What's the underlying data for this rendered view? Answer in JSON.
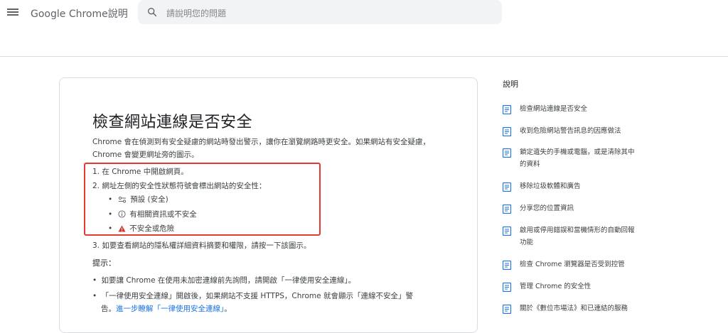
{
  "header": {
    "app_title": "Google Chrome說明",
    "search_placeholder": "請說明您的問題"
  },
  "article": {
    "title": "檢查網站連線是否安全",
    "intro": "Chrome 會在偵測到有安全疑慮的網站時發出警示，讓你在瀏覽網路時更安全。如果網站有安全疑慮，Chrome 會變更網址旁的圖示。",
    "steps": [
      "1. 在 Chrome 中開啟網頁。",
      "2. 網址左側的安全性狀態符號會標出網站的安全性：",
      "3. 如要查看網站的隱私權詳細資料摘要和權限，請按一下該圖示。"
    ],
    "status_items": [
      {
        "icon": "tune-icon",
        "label": "預設 (安全)"
      },
      {
        "icon": "info-icon",
        "label": "有相關資訊或不安全"
      },
      {
        "icon": "warning-icon",
        "label": "不安全或危險",
        "color": "#d93025"
      }
    ],
    "tips_heading": "提示：",
    "tips": [
      "如要讓 Chrome 在使用未加密連線前先詢問，請開啟「一律使用安全連線」。",
      "「一律使用安全連線」開啟後，如果網站不支援 HTTPS，Chrome 就會顯示「連線不安全」警"
    ],
    "tip2_cont": "告。",
    "tip2_link": "進一步瞭解「一律使用安全連線」",
    "tip2_end": "。",
    "highlight_color": "#e53935"
  },
  "sidebar": {
    "heading": "說明",
    "items": [
      {
        "label": "檢查網站連線是否安全"
      },
      {
        "label": "收到危險網站警告訊息的因應做法"
      },
      {
        "label": "鎖定遺失的手機或電腦，或是清除其中的資料"
      },
      {
        "label": "移除垃圾軟體和廣告"
      },
      {
        "label": "分享您的位置資訊"
      },
      {
        "label": "啟用或停用錯誤和當機情形的自動回報功能"
      },
      {
        "label": "檢查 Chrome 瀏覽器是否受到控管"
      },
      {
        "label": "管理 Chrome 的安全性"
      },
      {
        "label": "關於《數位市場法》和已連結的服務"
      }
    ],
    "icon_color": "#1a73e8"
  }
}
